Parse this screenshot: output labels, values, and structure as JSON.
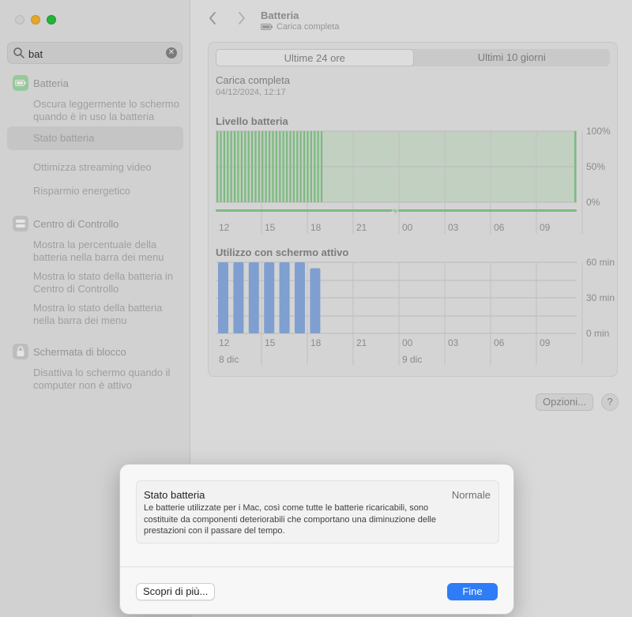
{
  "search": {
    "value": "bat",
    "clear_icon": "clear-icon"
  },
  "sidebar": {
    "groups": [
      {
        "label": "Batteria",
        "icon": "battery-icon",
        "icon_color": "#7fd286",
        "items": [
          {
            "label": "Oscura leggermente lo schermo quando è in uso la batteria"
          },
          {
            "label": "Stato batteria",
            "selected": true
          },
          {
            "label": "Ottimizza streaming video"
          },
          {
            "label": "Risparmio energetico"
          }
        ]
      },
      {
        "label": "Centro di Controllo",
        "icon": "control-center-icon",
        "icon_color": "#bdbdbd",
        "items": [
          {
            "label": "Mostra la percentuale della batteria nella barra dei menu"
          },
          {
            "label": "Mostra lo stato della batteria in Centro di Controllo"
          },
          {
            "label": "Mostra lo stato della batteria nella barra dei menu"
          }
        ]
      },
      {
        "label": "Schermata di blocco",
        "icon": "lock-icon",
        "icon_color": "#bdbdbd",
        "items": [
          {
            "label": "Disattiva lo schermo quando il computer non è attivo"
          }
        ]
      }
    ]
  },
  "header": {
    "title": "Batteria",
    "subtitle": "Carica completa"
  },
  "tabs": [
    {
      "label": "Ultime 24 ore",
      "active": true
    },
    {
      "label": "Ultimi 10 giorni",
      "active": false
    }
  ],
  "charge": {
    "status": "Carica completa",
    "date": "04/12/2024, 12:17"
  },
  "chart_data": [
    {
      "type": "bar",
      "title": "Livello batteria",
      "x_ticks": [
        "12",
        "15",
        "18",
        "21",
        "00",
        "03",
        "06",
        "09"
      ],
      "y_ticks": [
        "100%",
        "50%",
        "0%"
      ],
      "ylim": [
        0,
        100
      ],
      "values": [
        100,
        100,
        100,
        100,
        100,
        100,
        100,
        100,
        100,
        100,
        100,
        100,
        100,
        100,
        100,
        100,
        100,
        100,
        100,
        100,
        100,
        100,
        100,
        100,
        100,
        100,
        100,
        100,
        100,
        100,
        100,
        100,
        100,
        100,
        100,
        100,
        100,
        100,
        100,
        100,
        100,
        100,
        100,
        100,
        100,
        100,
        100,
        100,
        100,
        100,
        100,
        100,
        100,
        100,
        100,
        100,
        100,
        100,
        100,
        100,
        100,
        100,
        100,
        100,
        100,
        100,
        100,
        100,
        100,
        100,
        100,
        100,
        100,
        100,
        100,
        100,
        100,
        100,
        100,
        100,
        100,
        100,
        100,
        100,
        100,
        100,
        100,
        100,
        100,
        100,
        100,
        100,
        100,
        100,
        100,
        100,
        100
      ],
      "charging_icon": "lightning-icon",
      "color": "#8ccf90"
    },
    {
      "type": "bar",
      "title": "Utilizzo con schermo attivo",
      "x_ticks": [
        "12",
        "15",
        "18",
        "21",
        "00",
        "03",
        "06",
        "09"
      ],
      "date_labels": [
        "8 dic",
        "9 dic"
      ],
      "y_ticks": [
        "60 min",
        "30 min",
        "0 min"
      ],
      "ylim": [
        0,
        60
      ],
      "values": [
        60,
        60,
        60,
        60,
        60,
        60,
        55,
        0,
        0,
        0,
        0,
        0,
        0,
        0,
        0,
        0,
        0,
        0,
        0,
        0,
        0,
        0,
        0,
        0
      ],
      "color": "#8eb1e8"
    }
  ],
  "buttons": {
    "options": "Opzioni...",
    "help": "?"
  },
  "sheet": {
    "title": "Stato batteria",
    "value": "Normale",
    "description": "Le batterie utilizzate per i Mac, così come tutte le batterie ricaricabili, sono costituite da componenti deteriorabili che comportano una diminuzione delle prestazioni con il passare del tempo.",
    "learn_more": "Scopri di più...",
    "done": "Fine"
  }
}
